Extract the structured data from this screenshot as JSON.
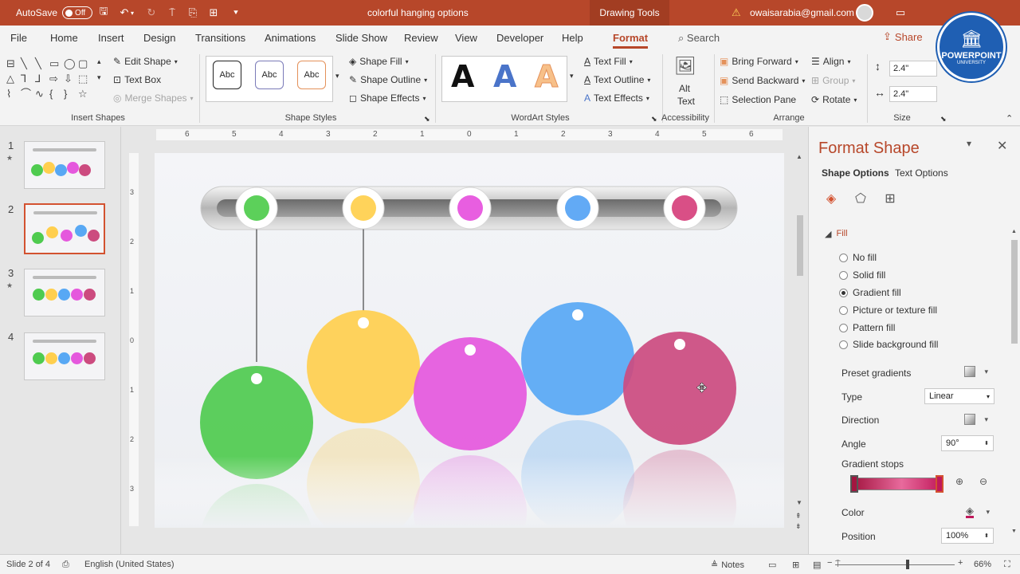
{
  "titlebar": {
    "autosave_label": "AutoSave",
    "autosave_state": "Off",
    "doc_title": "colorful hanging options",
    "context_tab": "Drawing Tools",
    "account": "owaisarabia@gmail.com"
  },
  "tabs": [
    "File",
    "Home",
    "Insert",
    "Design",
    "Transitions",
    "Animations",
    "Slide Show",
    "Review",
    "View",
    "Developer",
    "Help",
    "Format"
  ],
  "search_label": "Search",
  "share_label": "Share",
  "ribbon": {
    "insert_shapes": {
      "label": "Insert Shapes",
      "edit_shape": "Edit Shape",
      "text_box": "Text Box",
      "merge_shapes": "Merge Shapes"
    },
    "shape_styles": {
      "label": "Shape Styles",
      "sample": "Abc",
      "fill": "Shape Fill",
      "outline": "Shape Outline",
      "effects": "Shape Effects"
    },
    "wordart": {
      "label": "WordArt Styles",
      "letter": "A",
      "text_fill": "Text Fill",
      "text_outline": "Text Outline",
      "text_effects": "Text Effects"
    },
    "accessibility": {
      "label": "Accessibility",
      "alt_text_1": "Alt",
      "alt_text_2": "Text"
    },
    "arrange": {
      "label": "Arrange",
      "bring_forward": "Bring Forward",
      "send_backward": "Send Backward",
      "selection_pane": "Selection Pane",
      "align": "Align",
      "group": "Group",
      "rotate": "Rotate"
    },
    "size": {
      "label": "Size",
      "height": "2.4\"",
      "width": "2.4\""
    }
  },
  "logo": {
    "line1": "POWERPOINT",
    "line2": "UNIVERSITY"
  },
  "thumbnails": [
    {
      "num": "1",
      "star": "★"
    },
    {
      "num": "2",
      "star": ""
    },
    {
      "num": "3",
      "star": "★"
    },
    {
      "num": "4",
      "star": ""
    }
  ],
  "hruler_ticks": [
    "6",
    "5",
    "4",
    "3",
    "2",
    "1",
    "0",
    "1",
    "2",
    "3",
    "4",
    "5",
    "6"
  ],
  "vruler_ticks": [
    "3",
    "2",
    "1",
    "0",
    "1",
    "2",
    "3"
  ],
  "slide": {
    "bead_colors": [
      "#5cd05a",
      "#ffd35a",
      "#e85ee0",
      "#62aaf5",
      "#d94f86"
    ],
    "ball_colors": [
      "#4fcb4f",
      "#ffcf4e",
      "#e558dd",
      "#58a8f4",
      "#cc4b7f"
    ]
  },
  "format_pane": {
    "title": "Format Shape",
    "tab_shape": "Shape Options",
    "tab_text": "Text Options",
    "section": "Fill",
    "fill_options": [
      "No fill",
      "Solid fill",
      "Gradient fill",
      "Picture or texture fill",
      "Pattern fill",
      "Slide background fill"
    ],
    "selected_fill": 2,
    "preset_label": "Preset gradients",
    "type_label": "Type",
    "type_value": "Linear",
    "direction_label": "Direction",
    "angle_label": "Angle",
    "angle_value": "90°",
    "stops_label": "Gradient stops",
    "color_label": "Color",
    "position_label": "Position",
    "position_value": "100%"
  },
  "statusbar": {
    "slide_info": "Slide 2 of 4",
    "language": "English (United States)",
    "notes": "Notes",
    "zoom": "66%"
  },
  "colors": {
    "accent": "#b7472a",
    "selection": "#d35230"
  }
}
